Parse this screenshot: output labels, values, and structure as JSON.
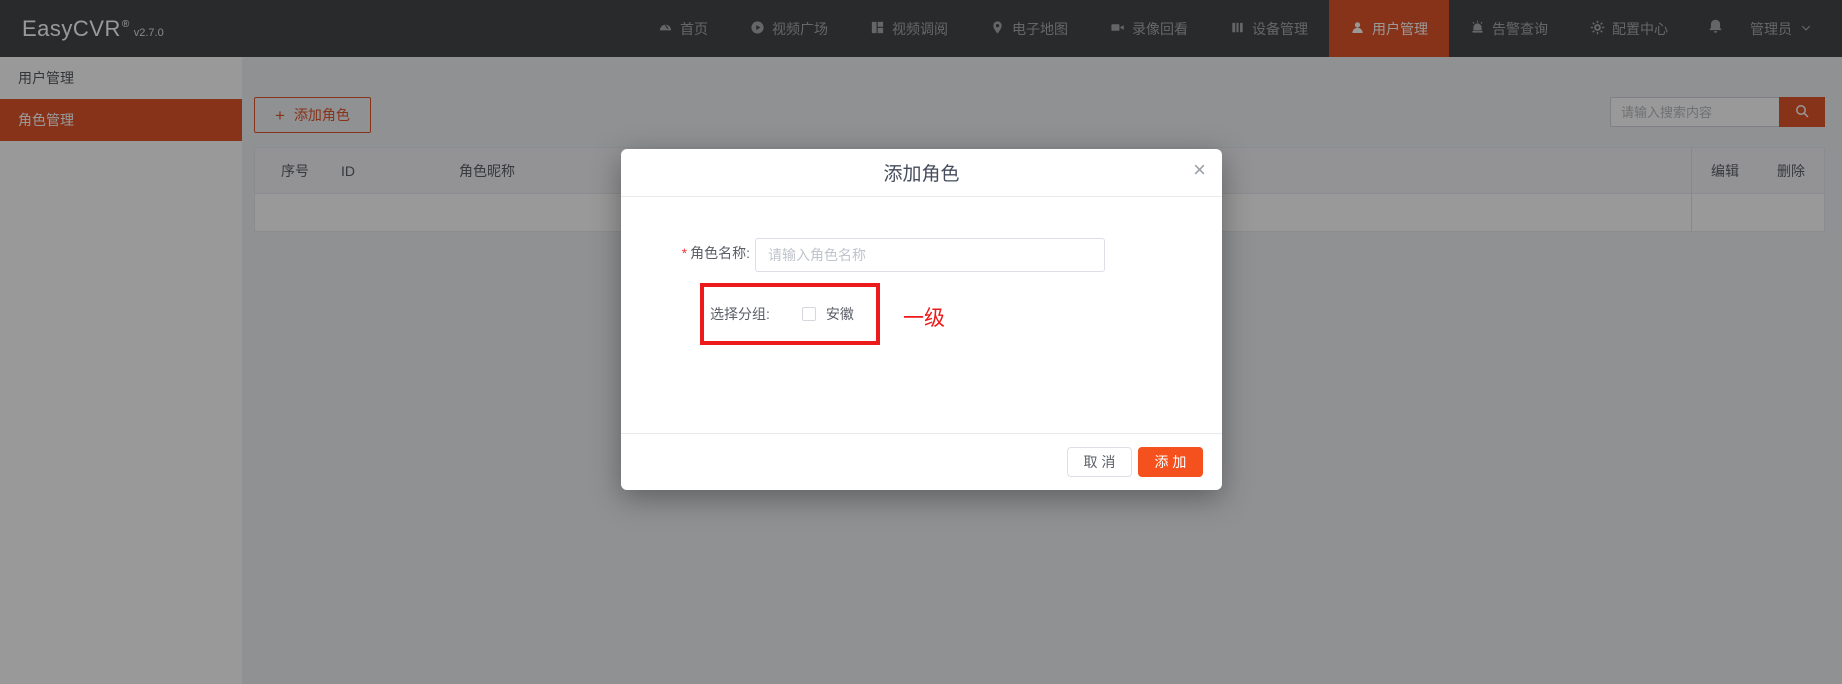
{
  "navbar": {
    "logo": "EasyCVR",
    "registered_mark": "®",
    "version": "v2.7.0",
    "items": [
      {
        "label": "首页",
        "icon": "dashboard-icon",
        "active": false
      },
      {
        "label": "视频广场",
        "icon": "play-icon",
        "active": false
      },
      {
        "label": "视频调阅",
        "icon": "layout-icon",
        "active": false
      },
      {
        "label": "电子地图",
        "icon": "map-pin-icon",
        "active": false
      },
      {
        "label": "录像回看",
        "icon": "camera-icon",
        "active": false
      },
      {
        "label": "设备管理",
        "icon": "devices-icon",
        "active": false
      },
      {
        "label": "用户管理",
        "icon": "user-icon",
        "active": true
      },
      {
        "label": "告警查询",
        "icon": "alarm-icon",
        "active": false
      },
      {
        "label": "配置中心",
        "icon": "gear-icon",
        "active": false
      }
    ],
    "bell_icon": "bell-icon",
    "user": {
      "name": "管理员",
      "dropdown_icon": "chevron-down-icon"
    }
  },
  "sidebar": {
    "items": [
      {
        "label": "用户管理",
        "active": false
      },
      {
        "label": "角色管理",
        "active": true
      }
    ]
  },
  "toolbar": {
    "add_role_label": "添加角色",
    "plus_glyph": "+",
    "search_placeholder": "请输入搜索内容",
    "search_icon": "magnifier-icon"
  },
  "table": {
    "columns": [
      "序号",
      "ID",
      "角色昵称"
    ],
    "fixed_columns": [
      "编辑",
      "删除"
    ],
    "rows": []
  },
  "modal": {
    "title": "添加角色",
    "close_glyph": "×",
    "fields": {
      "role_name": {
        "required_mark": "*",
        "label": "角色名称:",
        "value": "",
        "placeholder": "请输入角色名称"
      },
      "group": {
        "label": "选择分组:",
        "option": "安徽",
        "checked": false
      }
    },
    "buttons": {
      "cancel": "取 消",
      "submit": "添 加"
    }
  },
  "annotations": {
    "level_text": "一级",
    "box_note": "red highlight box around group selector",
    "color": "#ec1a1a"
  },
  "colors": {
    "brand_orange": "#e2552c",
    "submit_orange": "#f4511e",
    "navbar_bg": "#45474a",
    "annotation_red": "#ec1a1a"
  }
}
